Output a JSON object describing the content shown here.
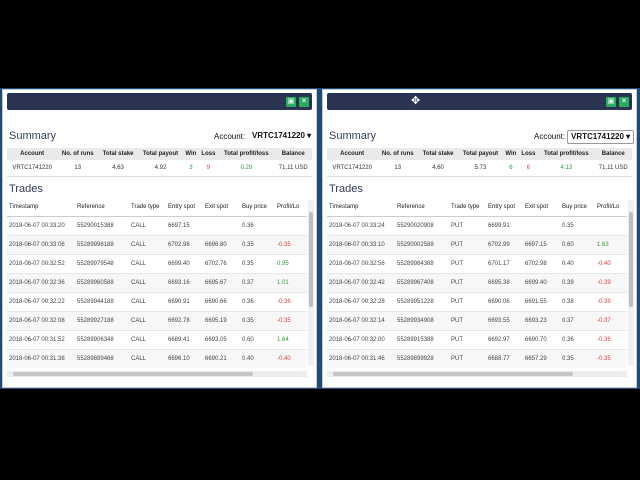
{
  "panels": [
    {
      "summary_title": "Summary",
      "account_label": "Account:",
      "account_value": "VRTC1741220",
      "summary_headers": [
        "Account",
        "No. of runs",
        "Total stake",
        "Total payout",
        "Win",
        "Loss",
        "Total profit/loss",
        "Balance"
      ],
      "summary_row": [
        "VRTC1741220",
        "13",
        "4.63",
        "4.92",
        "3",
        "9",
        "0.29",
        "71,11 USD"
      ],
      "trades_title": "Trades",
      "trade_headers": [
        "Timestamp",
        "Reference",
        "Trade type",
        "Entry spot",
        "Exit spot",
        "Buy price",
        "Profit/Lo"
      ],
      "trades": [
        [
          "2018-06-07 00:33:20",
          "55290015388",
          "CALL",
          "6697.15",
          "",
          "0.36",
          ""
        ],
        [
          "2018-06-07 00:33:06",
          "55289998188",
          "CALL",
          "6702.98",
          "6696.80",
          "0.35",
          "-0.35"
        ],
        [
          "2018-06-07 00:32:52",
          "55289979548",
          "CALL",
          "6699.40",
          "6702.76",
          "0.35",
          "0.95"
        ],
        [
          "2018-06-07 00:32:36",
          "55289960588",
          "CALL",
          "6693.16",
          "6695.67",
          "0.37",
          "1.01"
        ],
        [
          "2018-06-07 00:32:22",
          "55289944188",
          "CALL",
          "6690.91",
          "6690.66",
          "0.36",
          "-0.36"
        ],
        [
          "2018-06-07 00:32:08",
          "55289927188",
          "CALL",
          "6692.78",
          "6695.19",
          "0.35",
          "-0.35"
        ],
        [
          "2018-06-07 00:31:52",
          "55289906348",
          "CALL",
          "6689.41",
          "6693.05",
          "0.60",
          "1.64"
        ],
        [
          "2018-06-07 00:31:38",
          "55289889468",
          "CALL",
          "6696.10",
          "6690.21",
          "0.40",
          "-0.40"
        ],
        [
          "2018-06-07 00:31:24",
          "55289873908",
          "CALL",
          "6696.40",
          "6693.17",
          "0.39",
          "-0.39"
        ]
      ]
    },
    {
      "summary_title": "Summary",
      "account_label": "Account:",
      "account_value": "VRTC1741220",
      "summary_headers": [
        "Account",
        "No. of runs",
        "Total stake",
        "Total payout",
        "Win",
        "Loss",
        "Total profit/loss",
        "Balance"
      ],
      "summary_row": [
        "VRTC1741220",
        "13",
        "4.60",
        "5.73",
        "6",
        "6",
        "4.13",
        "71,11 USD"
      ],
      "trades_title": "Trades",
      "trade_headers": [
        "Timestamp",
        "Reference",
        "Trade type",
        "Entry spot",
        "Exit spot",
        "Buy price",
        "Profit/Lo"
      ],
      "trades": [
        [
          "2018-06-07 00:33:24",
          "55290020908",
          "PUT",
          "6699.91",
          "",
          "0.35",
          ""
        ],
        [
          "2018-06-07 00:33:10",
          "55290002588",
          "PUT",
          "6702.99",
          "6697.15",
          "0.60",
          "1.63"
        ],
        [
          "2018-06-07 00:32:56",
          "55289984368",
          "PUT",
          "6701.17",
          "6702.98",
          "0.40",
          "-0.40"
        ],
        [
          "2018-06-07 00:32:42",
          "55289967408",
          "PUT",
          "6695.38",
          "6699.40",
          "0.39",
          "-0.39"
        ],
        [
          "2018-06-07 00:32:28",
          "55289951228",
          "PUT",
          "6690.06",
          "6691.55",
          "0.38",
          "-0.38"
        ],
        [
          "2018-06-07 00:32:14",
          "55289934908",
          "PUT",
          "6693.55",
          "6693.23",
          "0.37",
          "-0.37"
        ],
        [
          "2018-06-07 00:32:00",
          "55289915388",
          "PUT",
          "6692.97",
          "6690.70",
          "0.36",
          "-0.36"
        ],
        [
          "2018-06-07 00:31:46",
          "55289899928",
          "PUT",
          "6688.77",
          "6657.29",
          "0.35",
          "-0.35"
        ],
        [
          "2018-06-07 00:31:32",
          "55289882408",
          "PUT",
          "6694.72",
          "6691.32",
          "0.35",
          "0.95"
        ]
      ]
    }
  ],
  "icons": {
    "save": "save-icon",
    "close": "close-icon",
    "move": "move-cursor-icon"
  },
  "colors": {
    "titlebar": "#2a3352",
    "accent_green": "#27ae60",
    "loss": "#d9413c",
    "profit": "#2e9a3a",
    "desktop": "#1e4b7a"
  }
}
